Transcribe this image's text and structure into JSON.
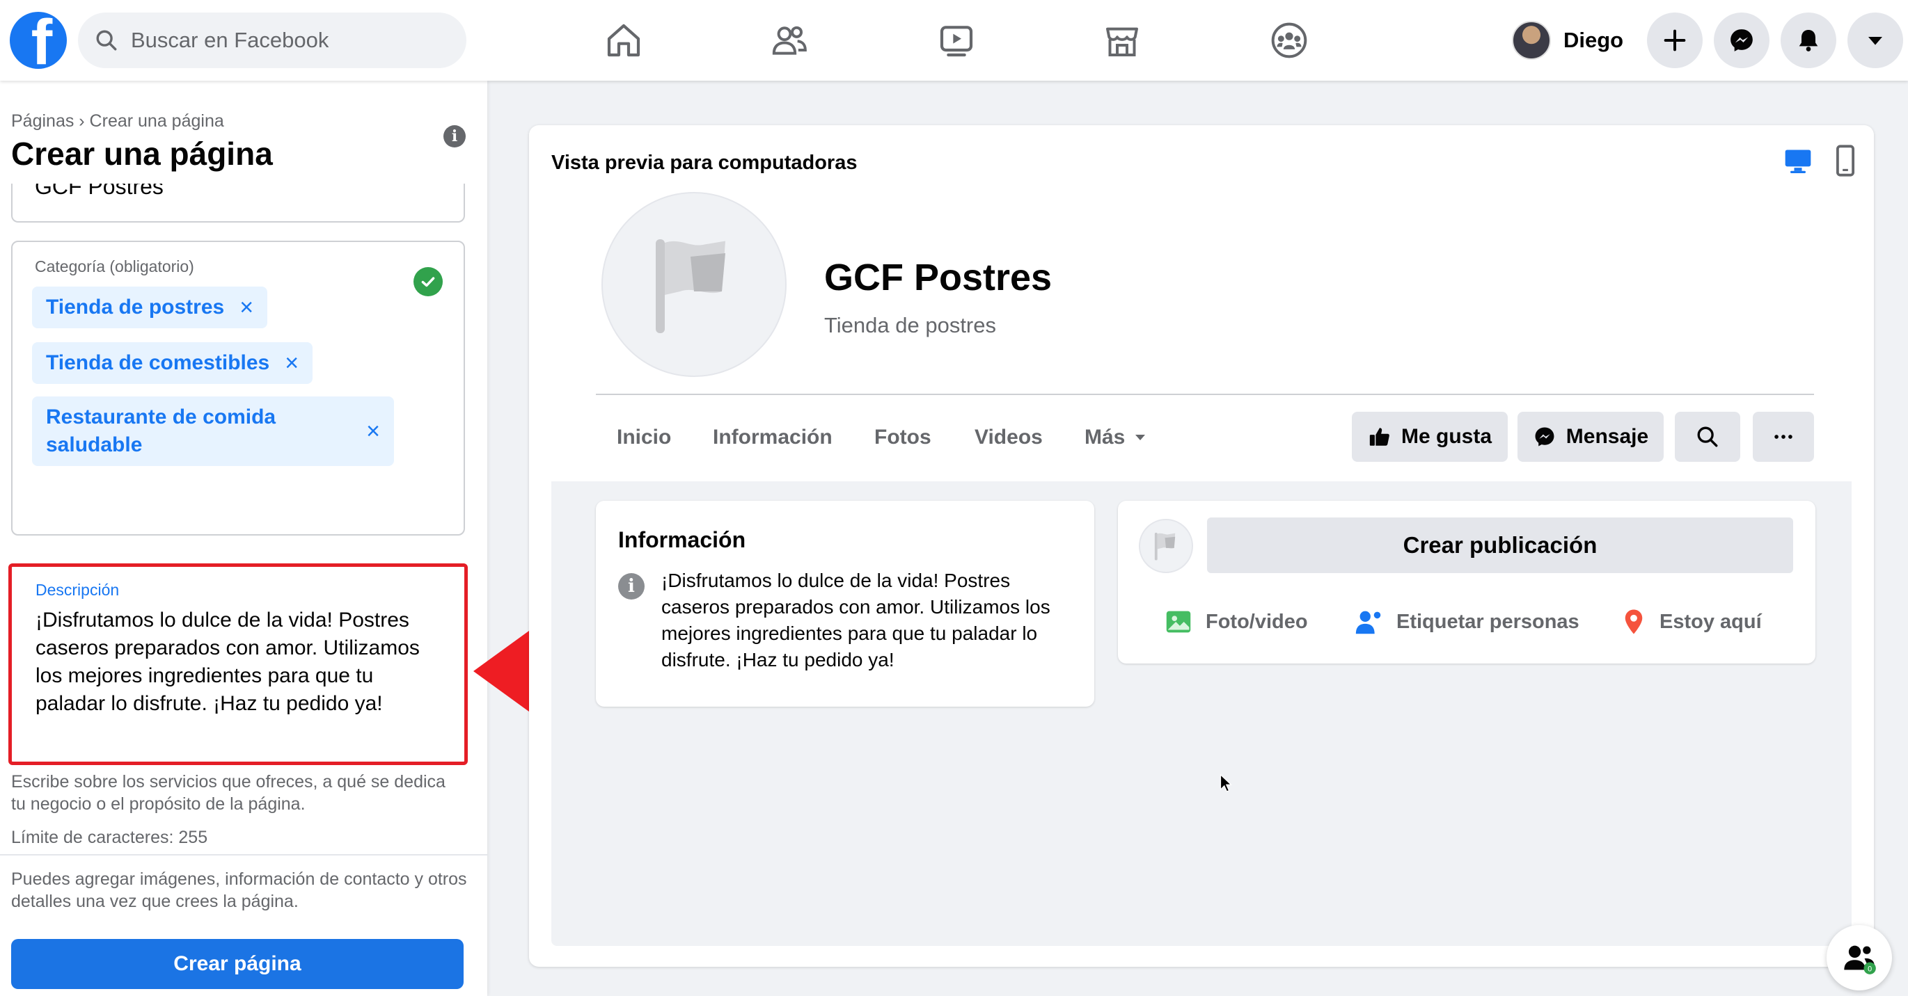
{
  "topbar": {
    "logo": "f",
    "search_placeholder": "Buscar en Facebook",
    "nav_icons": [
      "home-icon",
      "friends-icon",
      "watch-icon",
      "marketplace-icon",
      "groups-icon"
    ],
    "profile_name": "Diego",
    "right_icons": [
      "plus-icon",
      "messenger-icon",
      "bell-icon",
      "caret-down-icon"
    ]
  },
  "left": {
    "breadcrumb": "Páginas › Crear una página",
    "title": "Crear una página",
    "name_value": "GCF Postres",
    "category_label": "Categoría (obligatorio)",
    "categories": [
      {
        "label": "Tienda de postres"
      },
      {
        "label": "Tienda de comestibles"
      },
      {
        "label": "Restaurante de comida saludable"
      }
    ],
    "chip_remove": "×",
    "description_label": "Descripción",
    "description": "¡Disfrutamos lo dulce de la vida! Postres caseros preparados con amor. Utilizamos los mejores ingredientes para que tu paladar lo disfrute. ¡Haz tu pedido ya!",
    "help_text": "Escribe sobre los servicios que ofreces, a qué se dedica tu negocio o el propósito de la página.",
    "limit_text": "Límite de caracteres: 255",
    "note_text": "Puedes agregar imágenes, información de contacto y otros detalles una vez que crees la página.",
    "create_button": "Crear página"
  },
  "preview": {
    "title": "Vista previa para computadoras",
    "page_name": "GCF Postres",
    "page_category": "Tienda de postres",
    "tabs": [
      "Inicio",
      "Información",
      "Fotos",
      "Videos",
      "Más"
    ],
    "like_button": "Me gusta",
    "message_button": "Mensaje",
    "info_title": "Información",
    "info_text": "¡Disfrutamos lo dulce de la vida! Postres caseros preparados con amor. Utilizamos los mejores ingredientes para que tu paladar lo disfrute. ¡Haz tu pedido ya!",
    "create_post": "Crear publicación",
    "post_actions": [
      "Foto/video",
      "Etiquetar personas",
      "Estoy aquí"
    ]
  },
  "contacts_count": "0",
  "colors": {
    "brand": "#1877f2",
    "highlight": "#e41e26",
    "success": "#31a24c"
  }
}
